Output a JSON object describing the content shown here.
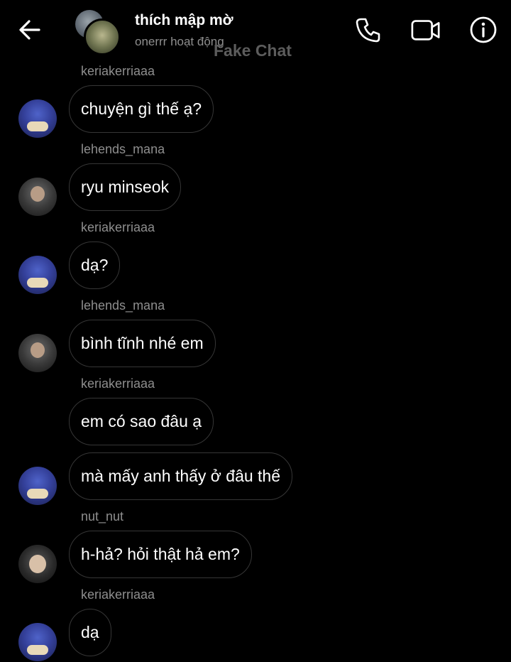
{
  "header": {
    "title": "thích mập mờ",
    "status": "onerrr hoạt động",
    "watermark": "Fake Chat",
    "icons": {
      "back": "arrow-left-icon",
      "call": "phone-icon",
      "video": "video-camera-icon",
      "info": "info-icon"
    }
  },
  "messages": [
    {
      "sender": "keriakerriaaa",
      "text": "chuyện gì thế ạ?"
    },
    {
      "sender": "lehends_mana",
      "text": "ryu minseok"
    },
    {
      "sender": "keriakerriaaa",
      "text": "dạ?"
    },
    {
      "sender": "lehends_mana",
      "text": "bình tĩnh nhé em"
    },
    {
      "sender": "keriakerriaaa",
      "text": "em có sao đâu ạ"
    },
    {
      "sender": "",
      "text": "mà mấy anh thấy ở đâu thế"
    },
    {
      "sender": "nut_nut",
      "text": "h-hả? hỏi thật hả em?"
    },
    {
      "sender": "keriakerriaaa",
      "text": "dạ"
    }
  ],
  "colors": {
    "background": "#000000",
    "bubble_border": "#363636",
    "secondary_text": "#8e8e8e"
  }
}
